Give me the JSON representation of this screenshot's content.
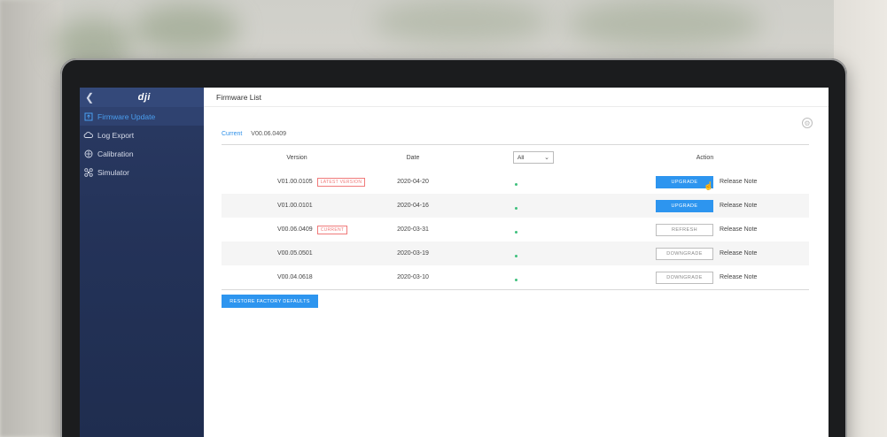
{
  "sidebar": {
    "logo": "dji",
    "items": [
      {
        "label": "Firmware Update",
        "icon": "firmware-icon",
        "active": true
      },
      {
        "label": "Log Export",
        "icon": "cloud-icon"
      },
      {
        "label": "Calibration",
        "icon": "calibration-icon"
      },
      {
        "label": "Simulator",
        "icon": "simulator-icon"
      }
    ]
  },
  "header": {
    "title": "Firmware List"
  },
  "current": {
    "label": "Current",
    "version": "V00.06.0409"
  },
  "table": {
    "headers": {
      "version": "Version",
      "date": "Date",
      "filter": "All",
      "action": "Action"
    },
    "rows": [
      {
        "version": "V01.00.0105",
        "tag": "LATEST VERSION",
        "date": "2020-04-20",
        "button": "UPGRADE",
        "note": "Release Note"
      },
      {
        "version": "V01.00.0101",
        "tag": "",
        "date": "2020-04-16",
        "button": "UPGRADE",
        "note": "Release Note"
      },
      {
        "version": "V00.06.0409",
        "tag": "CURRENT",
        "date": "2020-03-31",
        "button": "REFRESH",
        "note": "Release Note"
      },
      {
        "version": "V00.05.0501",
        "tag": "",
        "date": "2020-03-19",
        "button": "DOWNGRADE",
        "note": "Release Note"
      },
      {
        "version": "V00.04.0618",
        "tag": "",
        "date": "2020-03-10",
        "button": "DOWNGRADE",
        "note": "Release Note"
      }
    ]
  },
  "restore_button": "RESTORE FACTORY DEFAULTS",
  "colors": {
    "accent": "#2d95ef",
    "sidebar": "#243359",
    "tag": "#f07a7a",
    "status": "#3ec07c"
  }
}
